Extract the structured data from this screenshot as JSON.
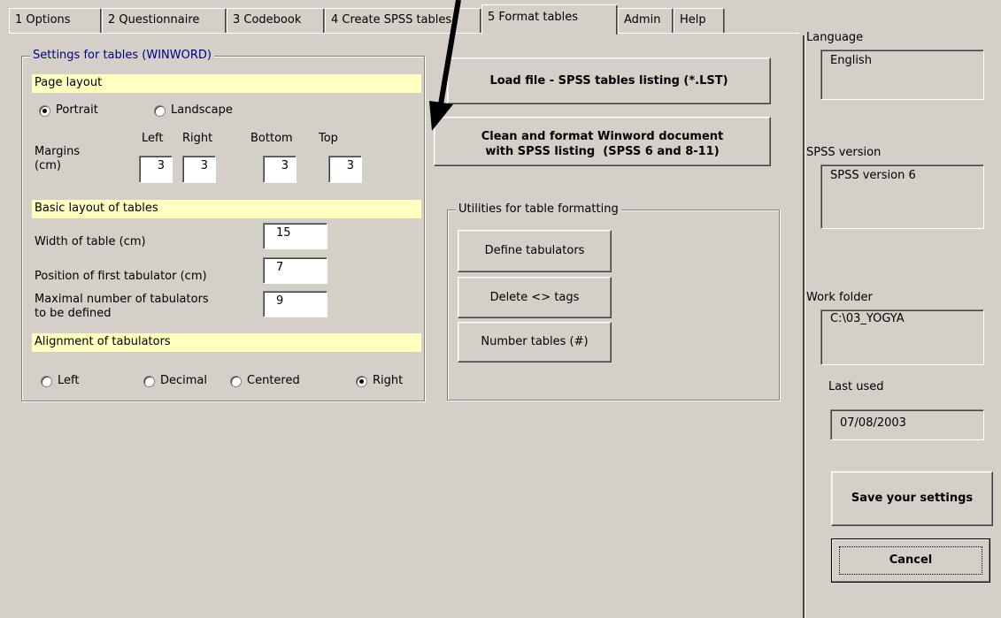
{
  "tabs": [
    {
      "label": "1 Options"
    },
    {
      "label": "2 Questionnaire"
    },
    {
      "label": "3 Codebook"
    },
    {
      "label": "4 Create SPSS tables"
    },
    {
      "label": "5 Format tables",
      "active": true
    },
    {
      "label": "Admin"
    },
    {
      "label": "Help"
    }
  ],
  "settings": {
    "title": "Settings for tables (WINWORD)",
    "page_layout": {
      "header": "Page layout",
      "portrait": "Portrait",
      "landscape": "Landscape",
      "selected": "Portrait"
    },
    "margins": {
      "label": "Margins\n(cm)",
      "left_label": "Left",
      "right_label": "Right",
      "bottom_label": "Bottom",
      "top_label": "Top",
      "left": "3",
      "right": "3",
      "bottom": "3",
      "top": "3"
    },
    "basic_layout": {
      "header": "Basic layout of tables",
      "width_label": "Width of table (cm)",
      "width_value": "15",
      "position_label": "Position of first tabulator (cm)",
      "position_value": "7",
      "max_label": "Maximal number of tabulators\nto be defined",
      "max_value": "9"
    },
    "alignment": {
      "header": "Alignment of tabulators",
      "left": "Left",
      "decimal": "Decimal",
      "centered": "Centered",
      "right": "Right",
      "selected": "Right"
    }
  },
  "actions": {
    "load_file": "Load file - SPSS tables listing  (*.LST)",
    "clean_format": "Clean and format Winword document\nwith SPSS listing  (SPSS 6 and 8-11)"
  },
  "utilities": {
    "title": "Utilities for table formatting",
    "define_tabulators": "Define tabulators",
    "delete_tags": "Delete <> tags",
    "number_tables": "Number tables (#)"
  },
  "sidebar": {
    "language_label": "Language",
    "language_value": "English",
    "spss_version_label": "SPSS version",
    "spss_version_value": "SPSS version 6",
    "work_folder_label": "Work folder",
    "work_folder_value": "C:\\03_YOGYA",
    "last_used_label": "Last used",
    "last_used_value": "07/08/2003",
    "save_label": "Save your settings",
    "cancel_label": "Cancel"
  },
  "colors": {
    "background": "#d4d0c8",
    "header_fill": "#ffffc0",
    "group_title_text": "#000080"
  },
  "annotation": {
    "type": "arrow-icon",
    "color": "#000000"
  }
}
